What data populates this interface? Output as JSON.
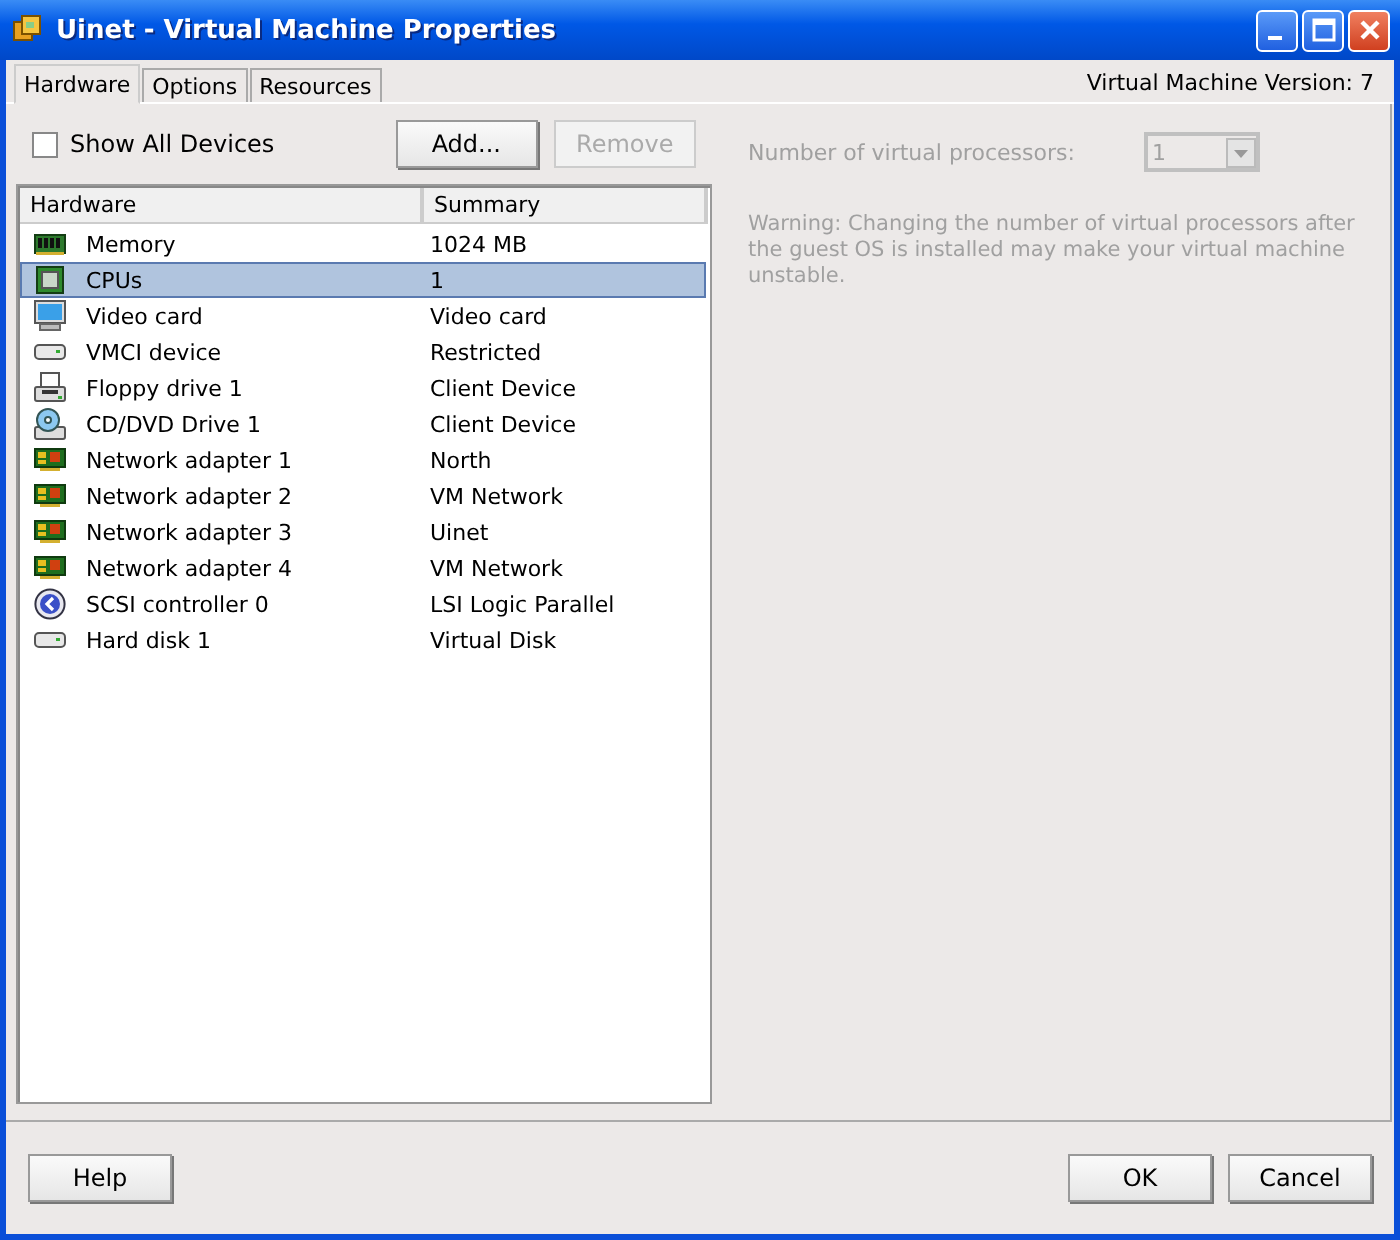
{
  "window": {
    "title": "Uinet - Virtual Machine Properties"
  },
  "tabs": [
    {
      "label": "Hardware",
      "selected": true
    },
    {
      "label": "Options",
      "selected": false
    },
    {
      "label": "Resources",
      "selected": false
    }
  ],
  "version_label": "Virtual Machine Version: 7",
  "show_all_devices": {
    "label": "Show All Devices",
    "checked": false
  },
  "buttons": [
    {
      "label": "Add...",
      "disabled": false
    },
    {
      "label": "Remove",
      "disabled": true
    }
  ],
  "table": {
    "columns": [
      "Hardware",
      "Summary"
    ],
    "rows": [
      {
        "kind": "memory",
        "name": "Memory",
        "summary": "1024 MB",
        "selected": false
      },
      {
        "kind": "cpu",
        "name": "CPUs",
        "summary": "1",
        "selected": true
      },
      {
        "kind": "monitor",
        "name": "Video card",
        "summary": "Video card",
        "selected": false
      },
      {
        "kind": "drive",
        "name": "VMCI device",
        "summary": "Restricted",
        "selected": false
      },
      {
        "kind": "floppy",
        "name": "Floppy drive 1",
        "summary": "Client Device",
        "selected": false
      },
      {
        "kind": "cd",
        "name": "CD/DVD Drive 1",
        "summary": "Client Device",
        "selected": false
      },
      {
        "kind": "network",
        "name": "Network adapter 1",
        "summary": "North",
        "selected": false
      },
      {
        "kind": "network",
        "name": "Network adapter 2",
        "summary": "VM Network",
        "selected": false
      },
      {
        "kind": "network",
        "name": "Network adapter 3",
        "summary": "Uinet",
        "selected": false
      },
      {
        "kind": "network",
        "name": "Network adapter 4",
        "summary": "VM Network",
        "selected": false
      },
      {
        "kind": "scsi",
        "name": "SCSI controller 0",
        "summary": "LSI Logic Parallel",
        "selected": false
      },
      {
        "kind": "drive",
        "name": "Hard disk 1",
        "summary": "Virtual Disk",
        "selected": false
      }
    ]
  },
  "processors": {
    "label": "Number of virtual processors:",
    "value": "1",
    "disabled": true
  },
  "warning": "Warning: Changing the number of virtual processors after the guest OS is installed may make your virtual machine unstable.",
  "footer_buttons": [
    {
      "label": "Help"
    },
    {
      "label": "OK"
    },
    {
      "label": "Cancel"
    }
  ]
}
